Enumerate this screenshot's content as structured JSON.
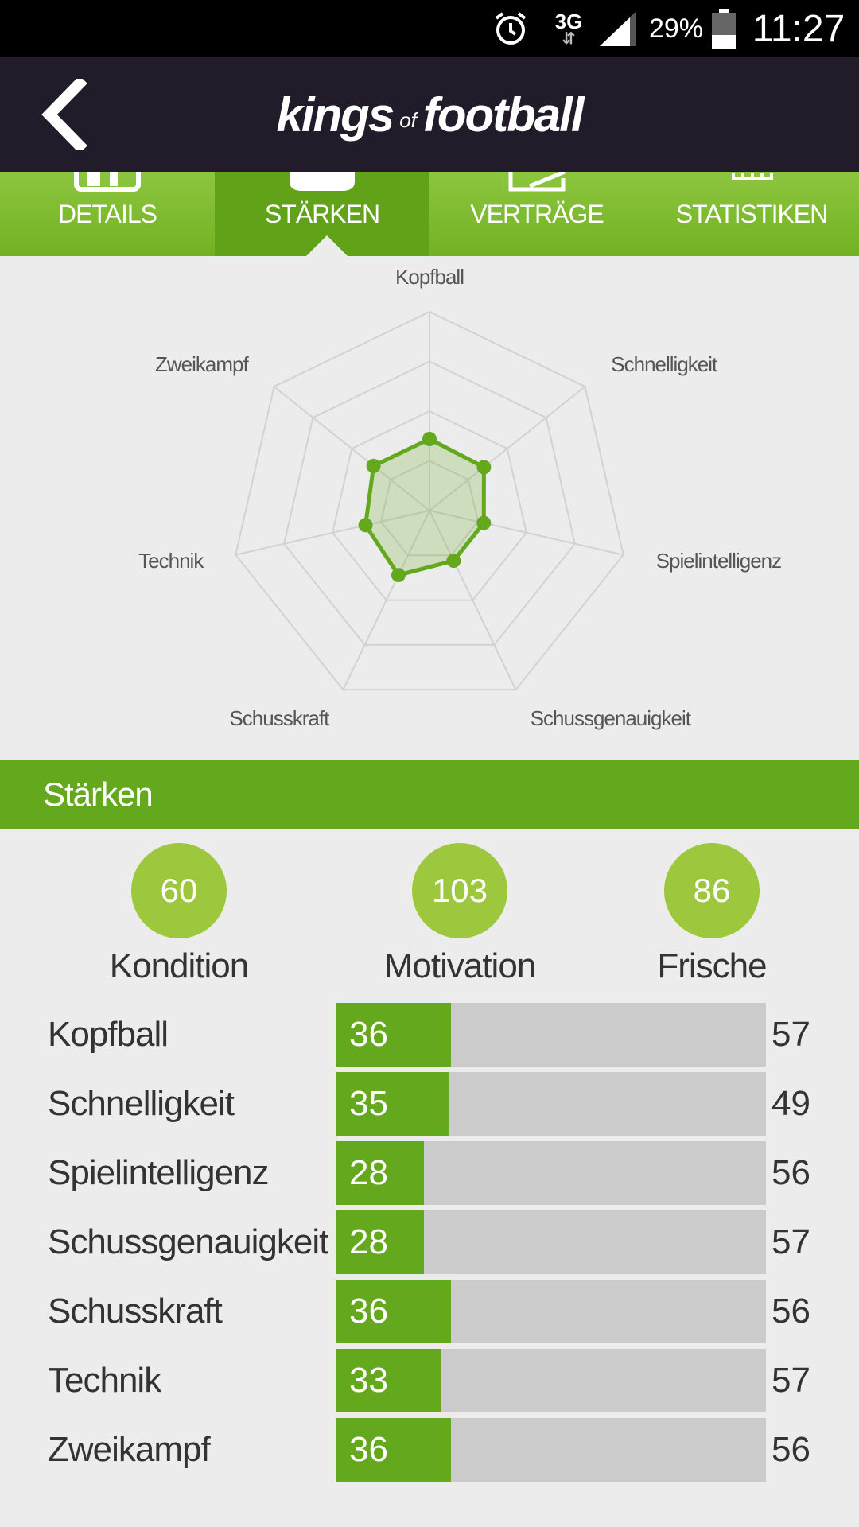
{
  "status_bar": {
    "network": "3G",
    "battery_percent": "29%",
    "time": "11:27",
    "icons": [
      "alarm-icon",
      "data-arrows-icon",
      "signal-icon",
      "battery-icon"
    ]
  },
  "header": {
    "brand_word1": "kings",
    "brand_word2": "of",
    "brand_word3": "football",
    "back_icon": "back-arrow-icon"
  },
  "tabs": [
    {
      "label": "DETAILS",
      "icon": "details-icon",
      "active": false
    },
    {
      "label": "STÄRKEN",
      "icon": "strength-icon",
      "active": true
    },
    {
      "label": "VERTRÄGE",
      "icon": "contract-icon",
      "active": false
    },
    {
      "label": "STATISTIKEN",
      "icon": "statistics-icon",
      "active": false
    }
  ],
  "radar": {
    "axes": [
      "Kopfball",
      "Schnelligkeit",
      "Spielintelligenz",
      "Schussgenauigkeit",
      "Schusskraft",
      "Technik",
      "Zweikampf"
    ],
    "values": [
      36,
      35,
      28,
      28,
      36,
      33,
      36
    ],
    "max": 100,
    "rings": 4
  },
  "section": {
    "title": "Stärken"
  },
  "summary": [
    {
      "value": "60",
      "label": "Kondition"
    },
    {
      "value": "103",
      "label": "Motivation"
    },
    {
      "value": "86",
      "label": "Frische"
    }
  ],
  "stats": [
    {
      "name": "Kopfball",
      "value": "36",
      "max": "57",
      "fill": 0.267
    },
    {
      "name": "Schnelligkeit",
      "value": "35",
      "max": "49",
      "fill": 0.261
    },
    {
      "name": "Spielintelligenz",
      "value": "28",
      "max": "56",
      "fill": 0.204
    },
    {
      "name": "Schussgenauigkeit",
      "value": "28",
      "max": "57",
      "fill": 0.204
    },
    {
      "name": "Schusskraft",
      "value": "36",
      "max": "56",
      "fill": 0.267
    },
    {
      "name": "Technik",
      "value": "33",
      "max": "57",
      "fill": 0.243
    },
    {
      "name": "Zweikampf",
      "value": "36",
      "max": "56",
      "fill": 0.267
    }
  ],
  "colors": {
    "brand_dark": "#221c2a",
    "green": "#64a81d",
    "light_green": "#9dc73c",
    "track": "#cbcbcb",
    "background": "#ececec"
  }
}
